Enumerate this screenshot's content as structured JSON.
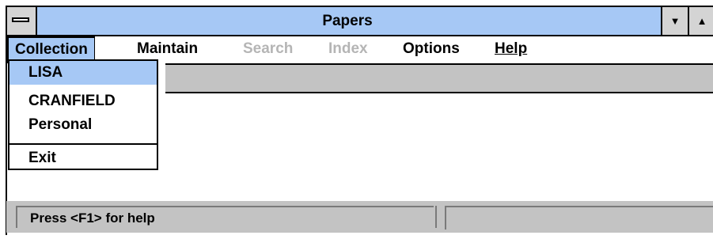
{
  "window": {
    "title": "Papers"
  },
  "title_buttons": {
    "minimize_glyph": "▼",
    "maximize_glyph": "▲"
  },
  "menubar": {
    "items": [
      {
        "label": "Collection",
        "state": "active"
      },
      {
        "label": "Maintain",
        "state": "enabled"
      },
      {
        "label": "Search",
        "state": "disabled"
      },
      {
        "label": "Index",
        "state": "disabled"
      },
      {
        "label": "Options",
        "state": "enabled"
      },
      {
        "label": "Help",
        "state": "enabled"
      }
    ]
  },
  "dropdown": {
    "items": [
      {
        "label": "LISA",
        "selected": true
      },
      {
        "label": "CRANFIELD",
        "selected": false
      },
      {
        "label": "Personal",
        "selected": false
      },
      {
        "label": "Exit",
        "selected": false
      }
    ]
  },
  "statusbar": {
    "left_text": "Press <F1> for help",
    "right_text": ""
  },
  "colors": {
    "titlebar": "#a6c8f5",
    "highlight": "#a6c8f5",
    "disabled_text": "#b5b5b5",
    "panel_gray": "#c3c3c3"
  }
}
